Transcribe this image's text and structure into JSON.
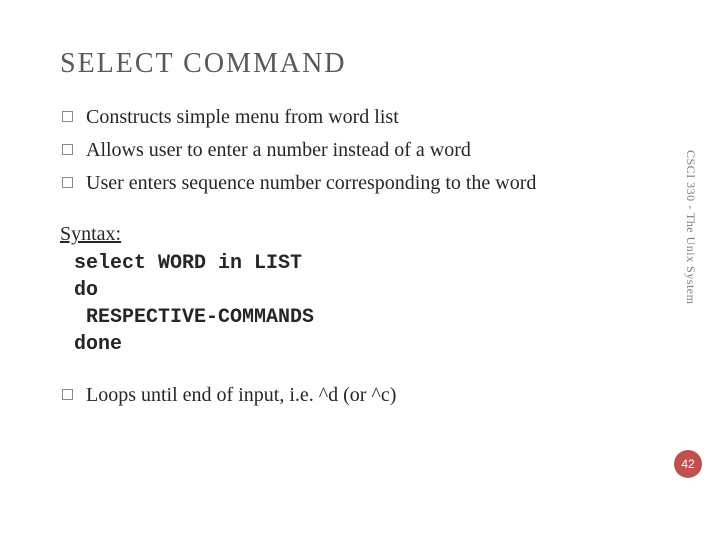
{
  "title": "SELECT COMMAND",
  "bullets1": [
    "Constructs simple menu from word list",
    "Allows user to enter a number instead of a word",
    "User enters sequence number corresponding to the word"
  ],
  "syntax_label": "Syntax:",
  "code": "select WORD in LIST\ndo\n RESPECTIVE-COMMANDS\ndone",
  "bullets2": [
    "Loops until end of input, i.e. ^d  (or ^c)"
  ],
  "side_label": "CSCI 330 - The Unix System",
  "page_number": "42",
  "colors": {
    "accent": "#c0504d"
  }
}
